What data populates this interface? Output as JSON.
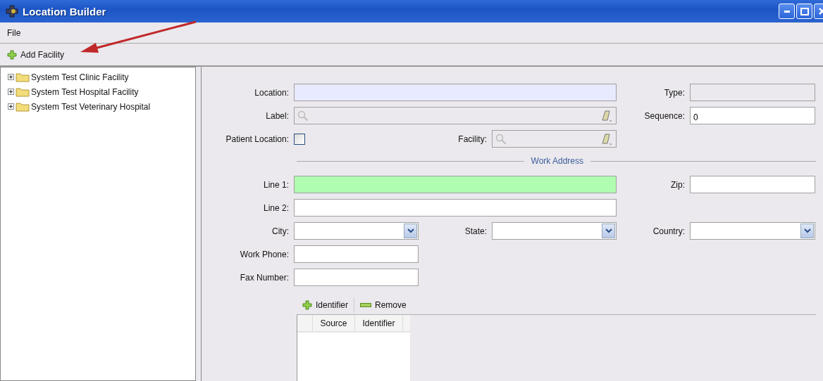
{
  "window": {
    "title": "Location Builder"
  },
  "menu": [
    "File"
  ],
  "toolbar": {
    "add_button": "Add Facility"
  },
  "tree": {
    "items": [
      {
        "label": "System Test Clinic Facility",
        "expanded": false
      },
      {
        "label": "System Test Hospital Facility",
        "expanded": false
      },
      {
        "label": "System Test Veterinary Hospital",
        "expanded": false
      }
    ]
  },
  "form": {
    "rows": [
      {
        "fields": [
          {
            "label": "Location:",
            "kind": "text",
            "color": "#e8eaff"
          },
          {
            "label": "Type:",
            "kind": "text",
            "disabled": true
          }
        ]
      },
      {
        "fields": [
          {
            "label": "Label:",
            "kind": "search"
          },
          {
            "label": "Sequence:",
            "kind": "text",
            "value": "0"
          }
        ]
      },
      {
        "fields": [
          {
            "label": "Patient Location:",
            "kind": "checkbox",
            "checked": false
          },
          {
            "label": "Facility:",
            "kind": "search"
          }
        ]
      }
    ],
    "section_title": "Work Address",
    "address_rows": [
      {
        "fields": [
          {
            "label": "Line 1:",
            "kind": "text",
            "color": "#b0fcb0"
          },
          {
            "label": "Zip:",
            "kind": "text"
          }
        ]
      },
      {
        "fields": [
          {
            "label": "Line 2:",
            "kind": "text"
          }
        ]
      },
      {
        "fields": [
          {
            "label": "City:",
            "kind": "combo"
          },
          {
            "label": "State:",
            "kind": "combo"
          },
          {
            "label": "Country:",
            "kind": "combo"
          }
        ]
      },
      {
        "fields": [
          {
            "label": "Work Phone:",
            "kind": "text"
          }
        ]
      },
      {
        "fields": [
          {
            "label": "Fax Number:",
            "kind": "text"
          }
        ]
      }
    ]
  },
  "identifiers": {
    "add_button": "Identifier",
    "remove_button": "Remove",
    "columns": [
      "Source",
      "Identifier"
    ]
  }
}
